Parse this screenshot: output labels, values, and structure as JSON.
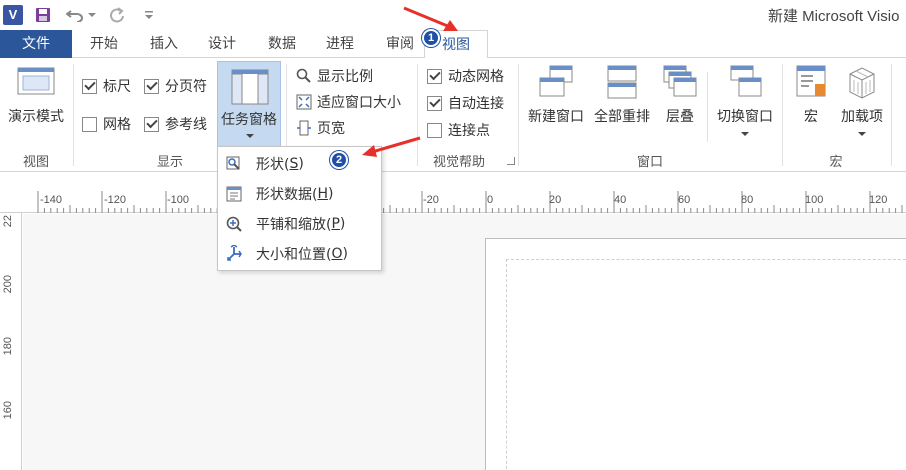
{
  "window": {
    "title": "新建 Microsoft Visio"
  },
  "qat": {
    "app_logo": "V"
  },
  "tabs": [
    {
      "label": "文件",
      "icon": ""
    },
    {
      "label": "开始"
    },
    {
      "label": "插入"
    },
    {
      "label": "设计"
    },
    {
      "label": "数据"
    },
    {
      "label": "进程"
    },
    {
      "label": "审阅"
    },
    {
      "label": "视图"
    }
  ],
  "ribbon": {
    "view_group": {
      "label": "视图",
      "presentation_mode": "演示模式"
    },
    "show_group": {
      "label": "显示",
      "ruler": "标尺",
      "page_breaks": "分页符",
      "grid": "网格",
      "guides": "参考线",
      "task_pane": "任务窗格"
    },
    "zoom_group": {
      "zoom": "显示比例",
      "fit_to_window": "适应窗口大小",
      "page_width": "页宽"
    },
    "visual_aids_group": {
      "label": "视觉帮助",
      "dynamic_grid": "动态网格",
      "auto_connect": "自动连接",
      "connection_points": "连接点"
    },
    "window_group": {
      "label": "窗口",
      "new_window": "新建窗口",
      "arrange_all": "全部重排",
      "cascade": "层叠",
      "switch_windows": "切换窗口"
    },
    "macros_group": {
      "label": "宏",
      "macros": "宏",
      "add_ons": "加载项"
    }
  },
  "dropdown": {
    "items": [
      {
        "text": "形状(",
        "key": "S",
        "end": ")"
      },
      {
        "text": "形状数据(",
        "key": "H",
        "end": ")"
      },
      {
        "text": "平铺和缩放(",
        "key": "P",
        "end": ")"
      },
      {
        "text": "大小和位置(",
        "key": "O",
        "end": ")"
      }
    ]
  },
  "markers": {
    "one": "1",
    "two": "2"
  },
  "ruler": {
    "h_ticks": [
      "-140",
      "-120",
      "-100",
      "-20",
      "0",
      "20",
      "40",
      "60",
      "80",
      "100",
      "120"
    ],
    "v_ticks": [
      "22",
      "200",
      "180",
      "160"
    ]
  },
  "colors": {
    "accent": "#2b579a",
    "arrow": "#e8302a",
    "marker": "#1f4fa8"
  }
}
